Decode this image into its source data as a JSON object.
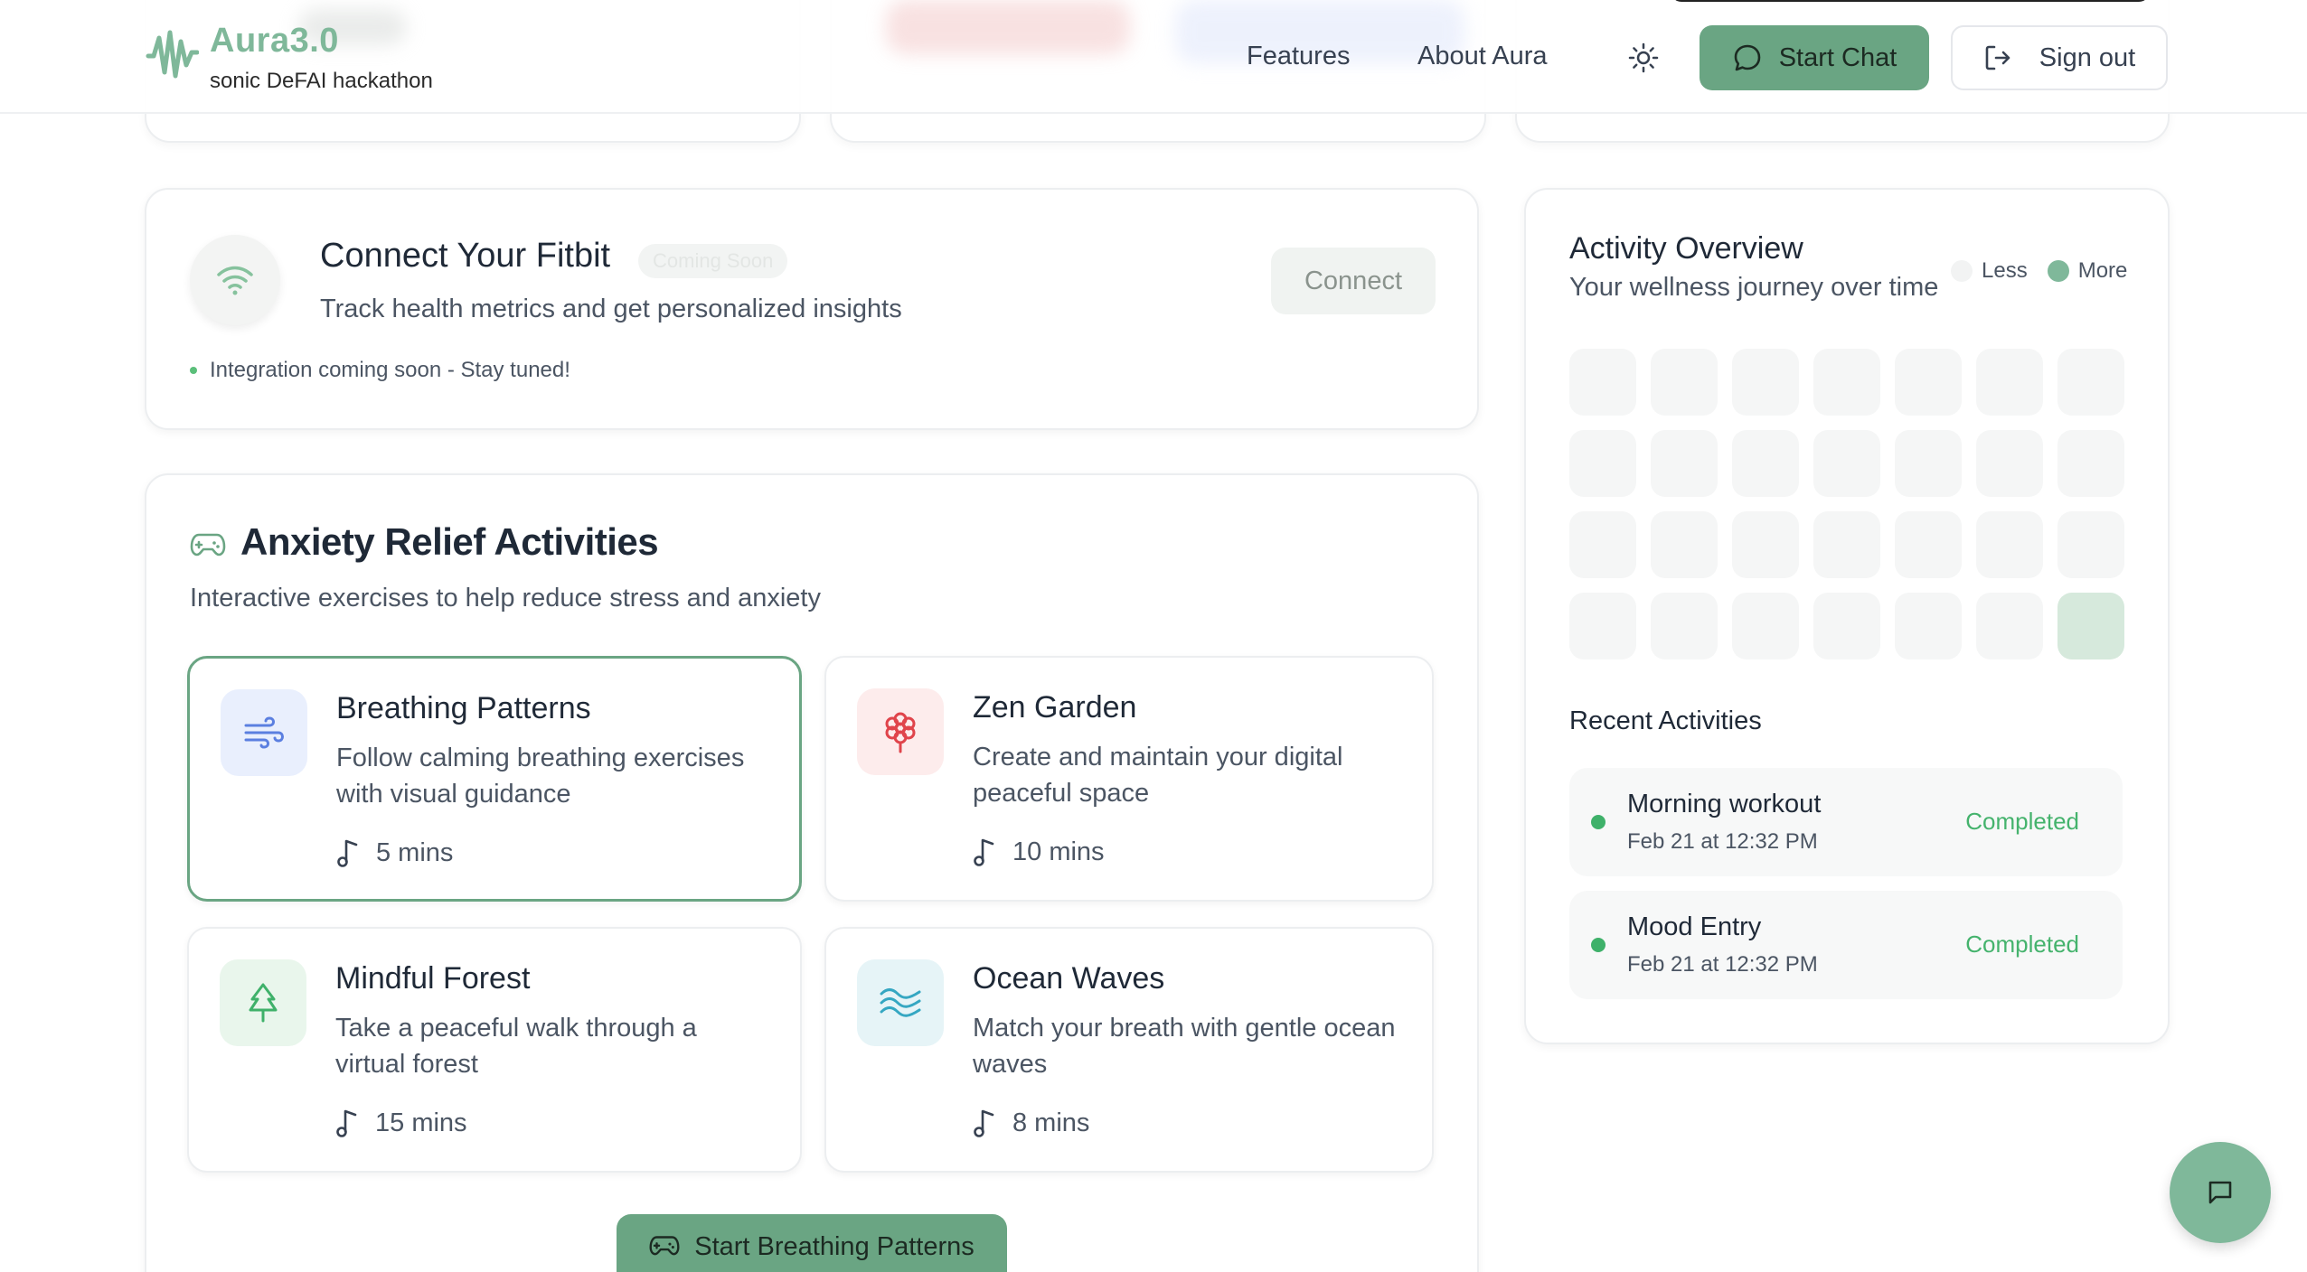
{
  "header": {
    "brand_title": "Aura3.0",
    "brand_subtitle": "sonic DeFAI hackathon",
    "nav": [
      "Features",
      "About Aura"
    ],
    "start_chat_label": "Start Chat",
    "sign_out_label": "Sign out",
    "accent_color": "#6aa583"
  },
  "fitbit": {
    "title": "Connect Your Fitbit",
    "badge": "Coming Soon",
    "subtitle": "Track health metrics and get personalized insights",
    "note": "Integration coming soon - Stay tuned!",
    "connect_label": "Connect",
    "icon": "wifi-icon"
  },
  "anxiety": {
    "title": "Anxiety Relief Activities",
    "subtitle": "Interactive exercises to help reduce stress and anxiety",
    "icon": "gamepad-icon",
    "activities": [
      {
        "title": "Breathing Patterns",
        "desc": "Follow calming breathing exercises with visual guidance",
        "duration": "5 mins",
        "icon": "wind-icon",
        "color": "#e9effd",
        "selected": true
      },
      {
        "title": "Zen Garden",
        "desc": "Create and maintain your digital peaceful space",
        "duration": "10 mins",
        "icon": "flower-icon",
        "color": "#fdecec"
      },
      {
        "title": "Mindful Forest",
        "desc": "Take a peaceful walk through a virtual forest",
        "duration": "15 mins",
        "icon": "tree-icon",
        "color": "#e9f6ec"
      },
      {
        "title": "Ocean Waves",
        "desc": "Match your breath with gentle ocean waves",
        "duration": "8 mins",
        "icon": "waves-icon",
        "color": "#e6f4f7"
      }
    ],
    "start_label": "Start Breathing Patterns"
  },
  "overview": {
    "title": "Activity Overview",
    "subtitle": "Your wellness journey over time",
    "legend_less": "Less",
    "legend_more": "More",
    "recent_title": "Recent Activities",
    "recent": [
      {
        "name": "Morning workout",
        "time": "Feb 21 at 12:32 PM",
        "status": "Completed"
      },
      {
        "name": "Mood Entry",
        "time": "Feb 21 at 12:32 PM",
        "status": "Completed"
      }
    ]
  }
}
